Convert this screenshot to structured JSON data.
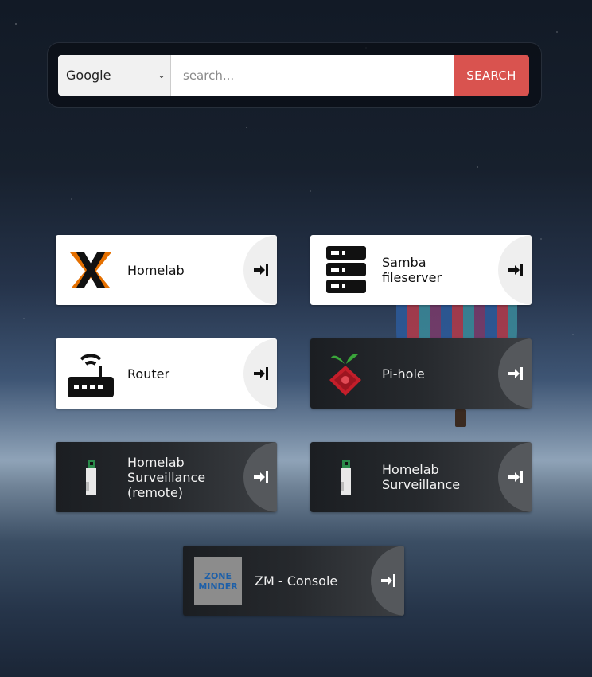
{
  "search": {
    "engine": "Google",
    "placeholder": "search...",
    "button_label": "SEARCH"
  },
  "tiles": {
    "homelab": {
      "label": "Homelab"
    },
    "samba": {
      "label_1": "Samba",
      "label_2": "fileserver"
    },
    "router": {
      "label": "Router"
    },
    "pihole": {
      "label": "Pi-hole"
    },
    "surv_remote": {
      "label_1": "Homelab",
      "label_2": "Surveillance",
      "label_3": "(remote)"
    },
    "surv": {
      "label_1": "Homelab",
      "label_2": "Surveillance"
    },
    "zm": {
      "label": "ZM - Console",
      "logo_1": "ZONE",
      "logo_2": "MINDER"
    }
  },
  "colors": {
    "search_button": "#d9534f",
    "proxmox_orange": "#e57000",
    "pihole_red": "#c41e2a",
    "pihole_green": "#3aa53a"
  }
}
